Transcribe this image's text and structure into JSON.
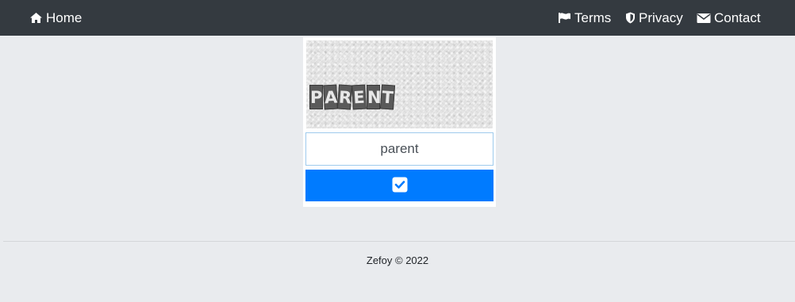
{
  "navbar": {
    "home_label": "Home",
    "terms_label": "Terms",
    "privacy_label": "Privacy",
    "contact_label": "Contact",
    "icons": {
      "home": "home-icon",
      "terms": "flag-icon",
      "privacy": "shield-icon",
      "contact": "envelope-icon"
    },
    "background_color": "#343a40"
  },
  "captcha": {
    "image_text": "PARENT",
    "input_value": "parent",
    "submit_icon": "check-square-icon",
    "submit_color": "#007bff"
  },
  "footer": {
    "text": "Zefoy © 2022"
  }
}
